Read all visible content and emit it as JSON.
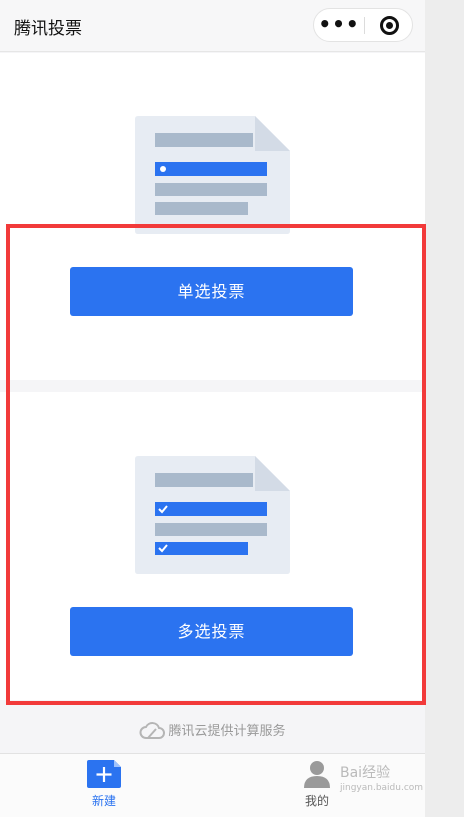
{
  "header": {
    "title": "腾讯投票"
  },
  "options": [
    {
      "label": "单选投票",
      "type": "single"
    },
    {
      "label": "多选投票",
      "type": "multiple"
    }
  ],
  "footer": {
    "provider_text": "腾讯云提供计算服务"
  },
  "tabbar": {
    "new_label": "新建",
    "mine_label": "我的"
  },
  "watermark": {
    "text": "Bai经验",
    "sub": "jingyan.baidu.com"
  },
  "colors": {
    "accent": "#2b73f0",
    "highlight": "#f23a3a",
    "doc_bg": "#e7ecf3",
    "doc_line": "#a9b9cb"
  }
}
